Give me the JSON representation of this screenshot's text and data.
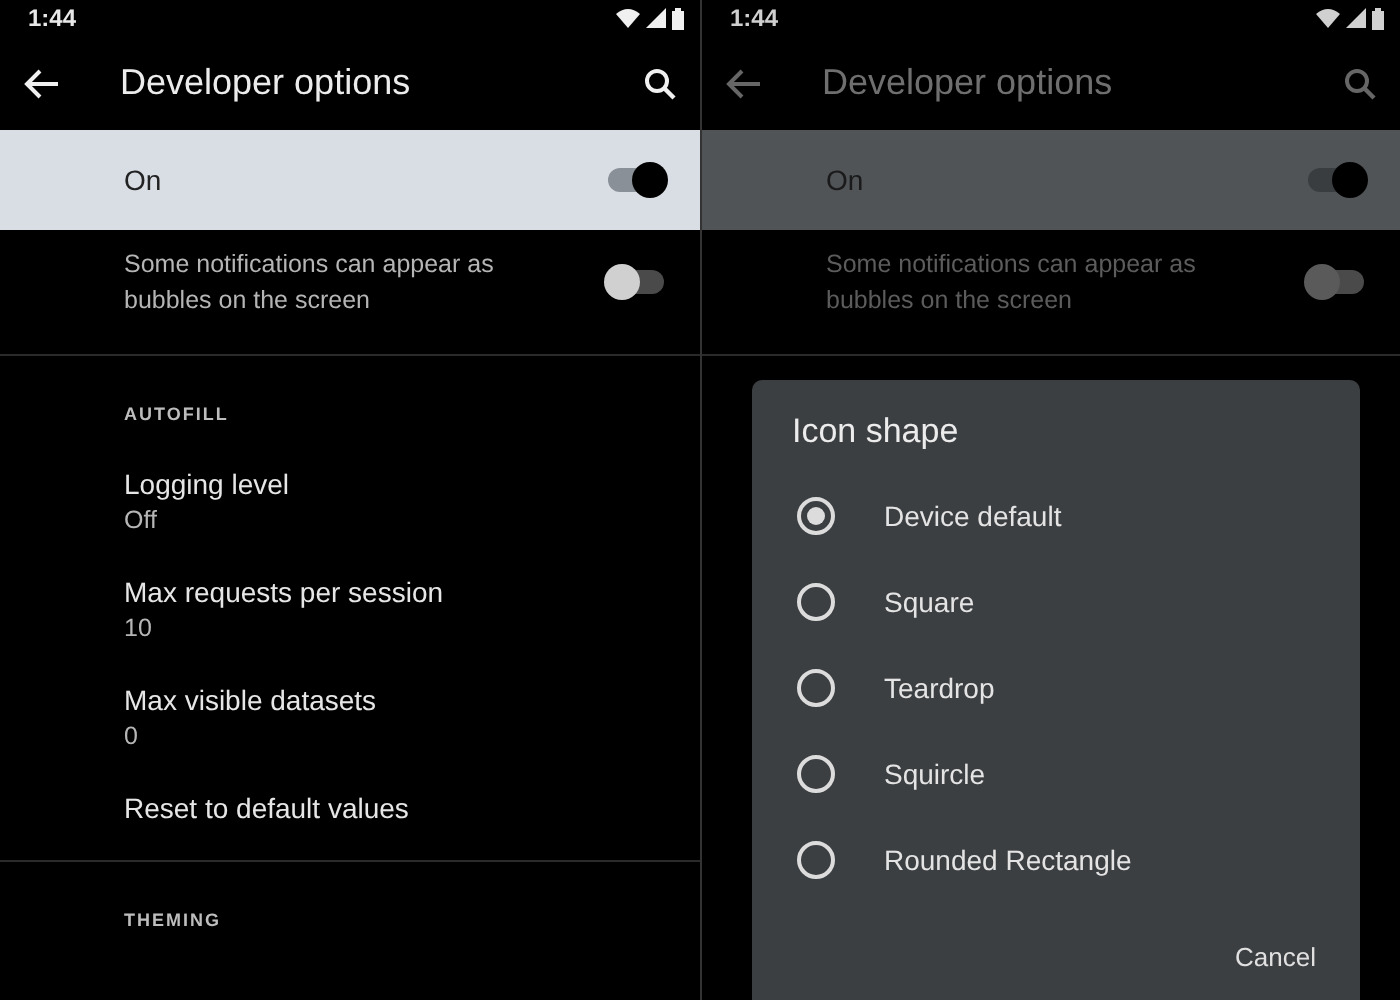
{
  "phones": [
    {
      "dimmed": false,
      "status_bar": {
        "time": "1:44"
      },
      "toolbar": {
        "title": "Developer options"
      },
      "master_switch": {
        "label": "On",
        "on": true
      },
      "items": [
        {
          "kind": "switch",
          "summary": "Some notifications can appear as bubbles on the screen",
          "on": false
        },
        {
          "kind": "header",
          "title": "AUTOFILL"
        },
        {
          "kind": "setting",
          "title": "Logging level",
          "summary": "Off"
        },
        {
          "kind": "setting",
          "title": "Max requests per session",
          "summary": "10"
        },
        {
          "kind": "setting",
          "title": "Max visible datasets",
          "summary": "0"
        },
        {
          "kind": "action",
          "title": "Reset to default values"
        },
        {
          "kind": "header",
          "title": "THEMING"
        }
      ]
    },
    {
      "dimmed": true,
      "status_bar": {
        "time": "1:44"
      },
      "toolbar": {
        "title": "Developer options"
      },
      "master_switch": {
        "label": "On",
        "on": true
      },
      "items": [
        {
          "kind": "switch",
          "summary": "Some notifications can appear as bubbles on the screen",
          "on": false
        }
      ],
      "dialog": {
        "title": "Icon shape",
        "options": [
          {
            "label": "Device default",
            "selected": true
          },
          {
            "label": "Square",
            "selected": false
          },
          {
            "label": "Teardrop",
            "selected": false
          },
          {
            "label": "Squircle",
            "selected": false
          },
          {
            "label": "Rounded Rectangle",
            "selected": false
          }
        ],
        "buttons": [
          "Cancel"
        ]
      }
    }
  ]
}
